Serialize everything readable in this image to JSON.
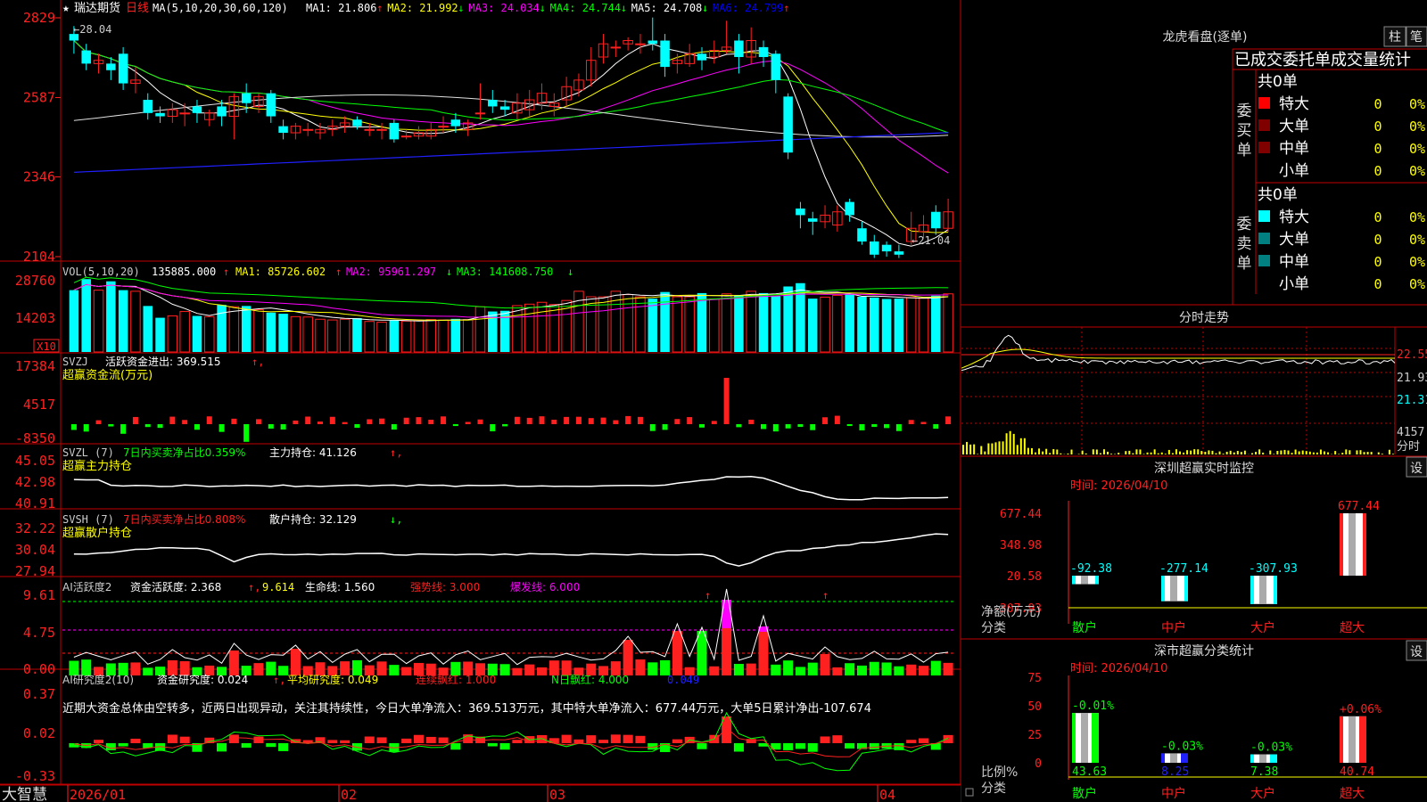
{
  "header": {
    "star": "★",
    "stock_name": "瑞达期货",
    "period": "日线",
    "ma_params": "MA(5,10,20,30,60,120)",
    "ma_items": [
      {
        "label": "MA1:",
        "value": "21.806",
        "arrow": "↑",
        "color": "#ffffff"
      },
      {
        "label": "MA2:",
        "value": "21.992",
        "arrow": "↓",
        "color": "#ffff00"
      },
      {
        "label": "MA3:",
        "value": "24.034",
        "arrow": "↓",
        "color": "#ff00ff"
      },
      {
        "label": "MA4:",
        "value": "24.744",
        "arrow": "↓",
        "color": "#00ff00"
      },
      {
        "label": "MA5:",
        "value": "24.708",
        "arrow": "↓",
        "color": "#ffffff"
      },
      {
        "label": "MA6:",
        "value": "24.799",
        "arrow": "↑",
        "color": "#0000ff"
      }
    ]
  },
  "price_axis": [
    "2829",
    "2587",
    "2346",
    "2104"
  ],
  "price_marks": {
    "high": "28.04",
    "low": "21.04"
  },
  "vol": {
    "title": "VOL(5,10,20)",
    "value": "135885.000",
    "arrow": "↑",
    "ma1": "MA1: 85726.602",
    "ma1_arrow": "↑",
    "ma2": "MA2: 95961.297",
    "ma2_arrow": "↓",
    "ma3": "MA3: 141608.750",
    "ma3_arrow": "↓",
    "axis": [
      "28760",
      "14203"
    ],
    "unit": "X10"
  },
  "svzj": {
    "title": "SVZJ",
    "label": "活跃资金进出:",
    "value": "369.515",
    "arrow": "↑",
    "subtitle": "超赢资金流(万元)",
    "axis": [
      "17384",
      "4517",
      "-8350"
    ]
  },
  "svzl": {
    "title": "SVZL (7)",
    "text": "7日内买卖净占比0.359%",
    "label": "主力持仓:",
    "value": "41.126",
    "arrow": "↑",
    "subtitle": "超赢主力持仓",
    "axis": [
      "45.05",
      "42.98",
      "40.91"
    ]
  },
  "svsh": {
    "title": "SVSH (7)",
    "text": "7日内买卖净占比0.808%",
    "label": "散户持仓:",
    "value": "32.129",
    "arrow": "↓",
    "subtitle": "超赢散户持仓",
    "axis": [
      "32.22",
      "30.04",
      "27.94"
    ]
  },
  "ai_act": {
    "title": "AI活跃度2",
    "label": "资金活跃度:",
    "v1": "2.368",
    "v2": "9.614",
    "life_label": "生命线:",
    "life": "1.560",
    "strong": "强势线: 3.000",
    "burst": "爆发线: 6.000",
    "axis": [
      "9.61",
      "4.75",
      "0.00"
    ]
  },
  "ai_res": {
    "title": "AI研究度2(10)",
    "label": "资金研究度:",
    "v": "0.024",
    "avg": "平均研究度: 0.049",
    "red": "连续飘红: 1.000",
    "nred": "N日飘红: 4.000",
    "last": "0.049",
    "axis": [
      "0.37",
      "0.02",
      "-0.33"
    ],
    "comment": "近期大资金总体由空转多，近两日出现异动，关注其持续性，今日大单净流入：369.513万元，其中特大单净流入：677.44万元，大单5日累计净出-107.674"
  },
  "xaxis": {
    "dates": [
      "2026/01",
      "02",
      "03",
      "04"
    ]
  },
  "brand": "大智慧",
  "dragon": {
    "title": "龙虎看盘(逐单)",
    "btn1": "柱",
    "btn2": "笔",
    "header": "已成交委托单成交量统计",
    "buy": {
      "side": "委买单",
      "total": "共0单",
      "rows": [
        [
          "特大",
          "0",
          "0%"
        ],
        [
          "大单",
          "0",
          "0%"
        ],
        [
          "中单",
          "0",
          "0%"
        ],
        [
          "小单",
          "0",
          "0%"
        ]
      ]
    },
    "sell": {
      "side": "委卖单",
      "total": "共0单",
      "rows": [
        [
          "特大",
          "0",
          "0%"
        ],
        [
          "大单",
          "0",
          "0%"
        ],
        [
          "中单",
          "0",
          "0%"
        ],
        [
          "小单",
          "0",
          "0%"
        ]
      ]
    }
  },
  "intraday": {
    "title": "分时走势",
    "axis": [
      "22.55",
      "21.93",
      "21.31"
    ],
    "vol": "4157",
    "unit": "分时"
  },
  "monitor": {
    "title": "深圳超赢实时监控",
    "btn": "设",
    "time": "时间: 2026/04/10",
    "axis": [
      "677.44",
      "348.98",
      "20.58",
      "-307.93"
    ],
    "values": [
      "-92.38",
      "-277.14",
      "-307.93",
      "677.44"
    ],
    "cats": [
      "散户",
      "中户",
      "大户",
      "超大"
    ],
    "ylab": "净额(万元)",
    "xlab": "分类"
  },
  "classify": {
    "title": "深市超赢分类统计",
    "btn": "设",
    "time": "时间: 2026/04/10",
    "axis": [
      "75",
      "50",
      "25",
      "0"
    ],
    "pct": [
      "-0.01%",
      "-0.03%",
      "-0.03%",
      "+0.06%"
    ],
    "values": [
      "43.63",
      "8.25",
      "7.38",
      "40.74"
    ],
    "cats": [
      "散户",
      "中户",
      "大户",
      "超大"
    ],
    "ylab": "比例%",
    "xlab": "分类"
  },
  "colors": {
    "up": "#ff2020",
    "down": "#00ffff",
    "green": "#00ff00",
    "frame": "#c00000"
  },
  "chart_data": {
    "type": "candlestick",
    "title": "瑞达期货 日线",
    "xlabel": "",
    "ylabel": "",
    "ylim": [
      21.04,
      28.29
    ],
    "dates": [
      "2026/01",
      "02",
      "03",
      "04"
    ],
    "ohlc": [
      [
        27.8,
        27.6,
        28.04,
        27.2
      ],
      [
        27.3,
        26.9,
        27.5,
        26.7
      ],
      [
        26.9,
        27.0,
        27.2,
        26.6
      ],
      [
        26.9,
        26.7,
        27.1,
        26.4
      ],
      [
        27.2,
        26.3,
        27.4,
        26.1
      ],
      [
        26.3,
        26.4,
        26.8,
        26.0
      ],
      [
        25.8,
        25.4,
        26.0,
        25.2
      ],
      [
        25.4,
        25.3,
        25.6,
        25.1
      ],
      [
        25.3,
        25.5,
        25.7,
        25.1
      ],
      [
        25.4,
        25.4,
        25.7,
        25.0
      ],
      [
        25.6,
        25.4,
        25.8,
        25.1
      ],
      [
        25.2,
        25.4,
        25.5,
        25.0
      ],
      [
        25.6,
        25.3,
        25.8,
        25.0
      ],
      [
        25.3,
        25.9,
        26.0,
        24.6
      ],
      [
        26.0,
        25.7,
        26.3,
        25.4
      ],
      [
        25.6,
        25.9,
        26.0,
        25.4
      ],
      [
        26.0,
        25.3,
        26.1,
        25.1
      ],
      [
        25.0,
        24.8,
        25.2,
        24.6
      ],
      [
        24.8,
        25.0,
        25.1,
        24.6
      ],
      [
        24.9,
        24.9,
        25.1,
        24.7
      ],
      [
        24.8,
        24.9,
        25.1,
        24.6
      ],
      [
        24.9,
        25.0,
        25.2,
        24.7
      ],
      [
        25.0,
        25.1,
        25.3,
        24.8
      ],
      [
        25.2,
        25.0,
        25.3,
        24.9
      ],
      [
        24.9,
        24.9,
        25.1,
        24.7
      ],
      [
        24.9,
        24.9,
        25.1,
        24.6
      ],
      [
        25.1,
        24.6,
        25.2,
        24.5
      ],
      [
        24.7,
        24.7,
        24.9,
        24.6
      ],
      [
        24.7,
        24.8,
        25.0,
        24.6
      ],
      [
        24.7,
        24.9,
        25.1,
        24.6
      ],
      [
        25.0,
        25.0,
        25.3,
        24.8
      ],
      [
        25.2,
        25.0,
        25.4,
        24.8
      ],
      [
        24.9,
        25.1,
        25.2,
        24.7
      ],
      [
        25.4,
        25.4,
        26.3,
        25.2
      ],
      [
        25.8,
        25.6,
        26.1,
        25.4
      ],
      [
        25.6,
        25.5,
        25.8,
        25.3
      ],
      [
        25.4,
        25.7,
        26.0,
        25.2
      ],
      [
        25.5,
        25.8,
        26.1,
        25.3
      ],
      [
        25.7,
        26.0,
        26.3,
        25.5
      ],
      [
        25.6,
        25.7,
        26.0,
        25.3
      ],
      [
        25.8,
        26.2,
        26.5,
        25.6
      ],
      [
        26.1,
        26.4,
        26.6,
        25.9
      ],
      [
        26.4,
        27.0,
        27.4,
        26.2
      ],
      [
        27.1,
        27.5,
        27.8,
        26.9
      ],
      [
        27.4,
        27.4,
        27.6,
        27.1
      ],
      [
        27.5,
        27.6,
        27.7,
        27.3
      ],
      [
        27.5,
        27.5,
        27.8,
        27.2
      ],
      [
        27.6,
        27.5,
        28.3,
        27.3
      ],
      [
        27.6,
        26.8,
        27.8,
        26.5
      ],
      [
        26.9,
        27.0,
        27.2,
        26.6
      ],
      [
        26.9,
        27.2,
        27.5,
        26.8
      ],
      [
        27.2,
        27.0,
        27.4,
        26.7
      ],
      [
        27.1,
        27.3,
        27.6,
        26.9
      ],
      [
        27.3,
        27.4,
        28.2,
        27.2
      ],
      [
        27.6,
        27.1,
        27.8,
        26.6
      ],
      [
        27.1,
        27.6,
        28.0,
        26.9
      ],
      [
        27.4,
        27.1,
        27.6,
        26.8
      ],
      [
        27.2,
        26.4,
        27.3,
        26.0
      ],
      [
        25.9,
        24.2,
        26.0,
        24.0
      ],
      [
        22.5,
        22.3,
        22.7,
        21.9
      ],
      [
        22.2,
        22.1,
        22.4,
        21.7
      ],
      [
        22.1,
        22.3,
        22.6,
        21.9
      ],
      [
        22.0,
        22.4,
        22.6,
        21.8
      ],
      [
        22.7,
        22.3,
        22.8,
        22.1
      ],
      [
        21.9,
        21.5,
        22.1,
        21.4
      ],
      [
        21.5,
        21.1,
        21.7,
        21.0
      ],
      [
        21.4,
        21.2,
        21.5,
        21.04
      ],
      [
        21.2,
        21.1,
        21.4,
        21.0
      ],
      [
        21.5,
        21.9,
        22.4,
        21.4
      ],
      [
        21.8,
        22.0,
        22.3,
        21.6
      ],
      [
        22.4,
        21.9,
        22.6,
        21.7
      ],
      [
        21.9,
        22.4,
        22.8,
        21.8
      ]
    ],
    "volume": [
      1680,
      1980,
      1680,
      1920,
      1680,
      1650,
      1250,
      930,
      980,
      1100,
      980,
      960,
      1280,
      1230,
      1250,
      1150,
      1070,
      1040,
      960,
      950,
      890,
      870,
      890,
      920,
      830,
      810,
      870,
      840,
      850,
      880,
      870,
      900,
      880,
      1230,
      1100,
      1120,
      1260,
      1300,
      1350,
      1290,
      1400,
      1650,
      1500,
      1500,
      1650,
      1560,
      1500,
      1450,
      1630,
      1500,
      1500,
      1600,
      1440,
      1580,
      1550,
      1650,
      1600,
      1520,
      1780,
      1870,
      1450,
      1490,
      1540,
      1580,
      1500,
      1480,
      1440,
      1450,
      1480,
      1460,
      1530,
      1580
    ]
  }
}
